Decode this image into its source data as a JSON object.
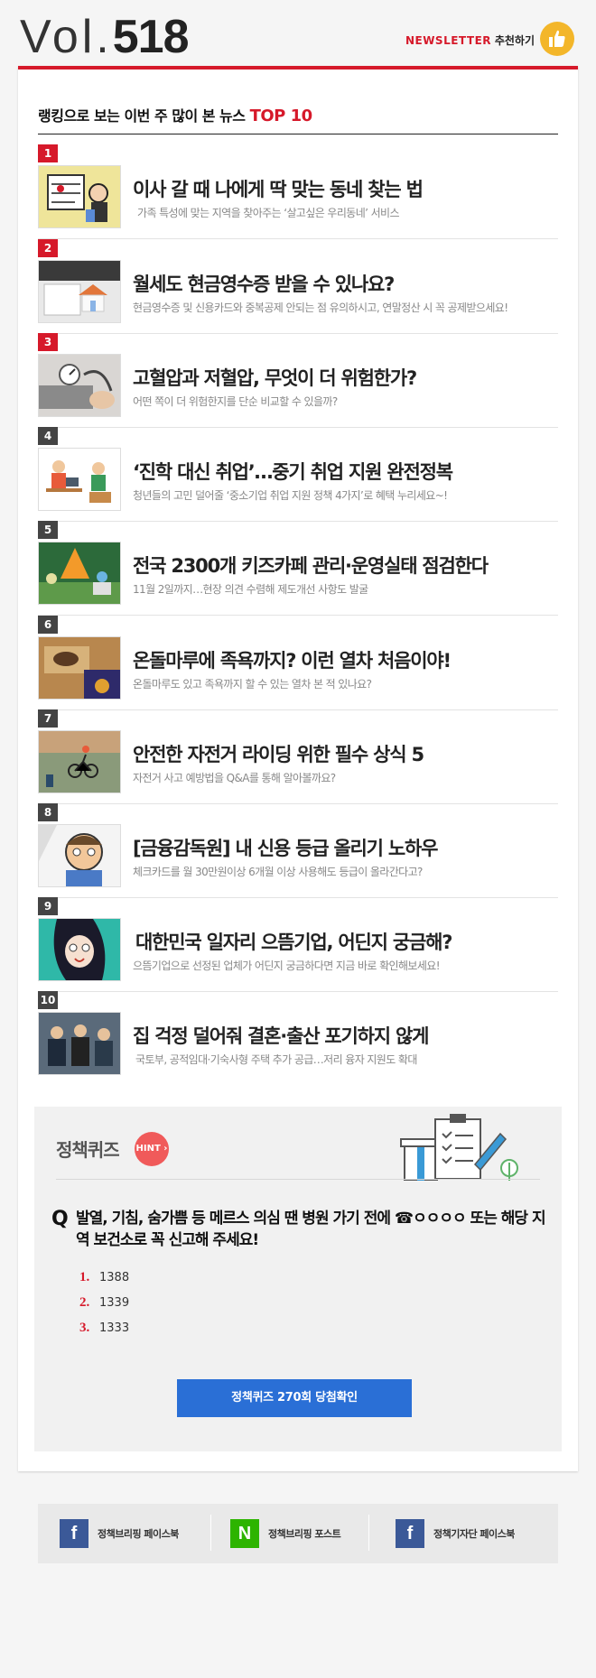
{
  "header": {
    "vol_prefix": "Vol.",
    "vol_number": "518",
    "newsletter_label": "NEWSLETTER",
    "recommend_label": "추천하기"
  },
  "ranking": {
    "title_main": "랭킹으로 보는 이번 주 많이 본 뉴스 ",
    "title_accent": "TOP 10",
    "items": [
      {
        "rank": "1",
        "title": "이사 갈 때 나에게 딱 맞는 동네 찾는 법",
        "subtitle": "가족 특성에 맞는 지역을 찾아주는 ‘살고싶은 우리동네’ 서비스"
      },
      {
        "rank": "2",
        "title": "월세도 현금영수증 받을 수 있나요?",
        "subtitle": "현금영수증 및 신용카드와 중복공제 안되는 점 유의하시고, 연말정산 시 꼭 공제받으세요!"
      },
      {
        "rank": "3",
        "title": "고혈압과 저혈압, 무엇이 더 위험한가?",
        "subtitle": "어떤 쪽이 더 위험한지를 단순 비교할 수 있을까?"
      },
      {
        "rank": "4",
        "title": "‘진학 대신 취업’…중기 취업 지원 완전정복",
        "subtitle": "청년들의 고민 덜어줄 ‘중소기업 취업 지원 정책 4가지’로 혜택 누리세요~!"
      },
      {
        "rank": "5",
        "title": "전국 2300개 키즈카페 관리·운영실태 점검한다",
        "subtitle": "11월 2일까지…현장 의견 수렴해 제도개선 사항도 발굴"
      },
      {
        "rank": "6",
        "title": "온돌마루에 족욕까지? 이런 열차 처음이야!",
        "subtitle": "온돌마루도 있고 족욕까지 할 수 있는 열차 본 적 있나요?"
      },
      {
        "rank": "7",
        "title": "안전한 자전거 라이딩 위한 필수 상식 5",
        "subtitle": "자전거 사고 예방법을 Q&A를 통해 알아볼까요?"
      },
      {
        "rank": "8",
        "title": "[금융감독원] 내 신용 등급 올리기 노하우",
        "subtitle": "체크카드를 월 30만원이상 6개월 이상 사용해도 등급이 올라간다고?"
      },
      {
        "rank": "9",
        "title": "대한민국 일자리 으뜸기업, 어딘지 궁금해?",
        "subtitle": "으뜸기업으로 선정된 업체가 어딘지 궁금하다면 지금 바로 확인해보세요!"
      },
      {
        "rank": "10",
        "title": "집 걱정 덜어줘 결혼·출산 포기하지 않게",
        "subtitle": "국토부, 공적임대·기숙사형 주택 추가 공급…저리 융자 지원도 확대"
      }
    ]
  },
  "quiz": {
    "title": "정책퀴즈",
    "hint_label": "HINT",
    "q_mark": "Q",
    "question": "발열, 기침, 숨가쁨 등 메르스 의심 땐 병원 가기 전에 ☎ㅇㅇㅇㅇ 또는 해당 지역 보건소로 꼭 신고해 주세요!",
    "options": [
      {
        "num": "1.",
        "text": "1388"
      },
      {
        "num": "2.",
        "text": "1339"
      },
      {
        "num": "3.",
        "text": "1333"
      }
    ],
    "button_label": "정책퀴즈 270회 당첨확인"
  },
  "social": [
    {
      "icon": "facebook-icon",
      "glyph": "f",
      "label": "정책브리핑 페이스북"
    },
    {
      "icon": "naver-post-icon",
      "glyph": "N",
      "label": "정책브리핑 포스트"
    },
    {
      "icon": "facebook-icon",
      "glyph": "f",
      "label": "정책기자단 페이스북"
    }
  ],
  "colors": {
    "accent_red": "#d6192a",
    "quiz_button_blue": "#2a6fd6",
    "hint_red": "#f05a5a",
    "thumb_yellow": "#f3b62a"
  }
}
